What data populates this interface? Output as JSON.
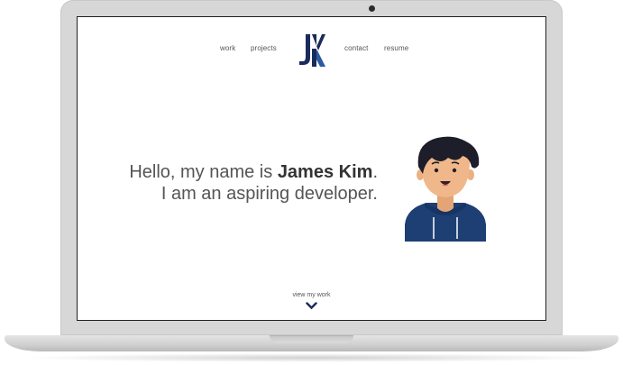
{
  "nav": {
    "work": "work",
    "projects": "projects",
    "contact": "contact",
    "resume": "resume",
    "logo_text": "JK"
  },
  "hero": {
    "greeting_prefix": "Hello, my name is ",
    "name": "James Kim",
    "greeting_suffix": ".",
    "tagline": "I am an aspiring developer."
  },
  "footer": {
    "view_work": "view my work"
  },
  "colors": {
    "brand_navy": "#1a2a5c",
    "hoodie_blue": "#1d3f73",
    "hair": "#1e1e2a",
    "skin": "#f0b88a",
    "text": "#555555"
  },
  "icons": {
    "scroll": "chevron-down-icon",
    "avatar": "avatar-illustration"
  }
}
